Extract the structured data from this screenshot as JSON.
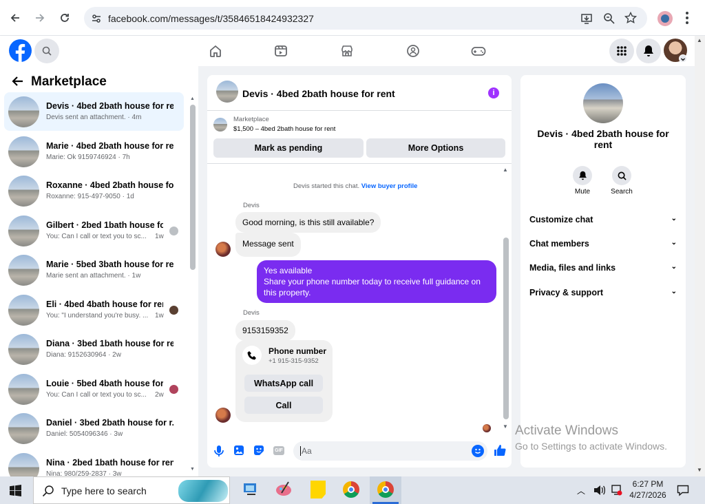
{
  "browser": {
    "url": "facebook.com/messages/t/35846518424932327"
  },
  "sidebar": {
    "title": "Marketplace",
    "conversations": [
      {
        "name": "Devis · 4bed 2bath house for rent",
        "snippet": "Devis sent an attachment. · 4m",
        "active": true
      },
      {
        "name": "Marie · 4bed 2bath house for re...",
        "snippet": "Marie: Ok 9159746924 · 7h"
      },
      {
        "name": "Roxanne · 4bed 2bath house fo...",
        "snippet": "Roxanne: 915-497-9050 · 1d"
      },
      {
        "name": "Gilbert · 2bed 1bath house fo...",
        "snippet": "You: Can I call or text you to sc...",
        "time": "1w"
      },
      {
        "name": "Marie · 5bed 3bath house for rent",
        "snippet": "Marie sent an attachment. · 1w"
      },
      {
        "name": "Eli · 4bed 4bath house for rent",
        "snippet": "You: \"I understand you're busy. ...",
        "time": "1w"
      },
      {
        "name": "Diana · 3bed 1bath house for ren",
        "snippet": "Diana: 9152630964 · 2w"
      },
      {
        "name": "Louie · 5bed 4bath house for ...",
        "snippet": "You: Can I call or text you to sc...",
        "time": "2w"
      },
      {
        "name": "Daniel · 3bed 2bath house for r...",
        "snippet": "Daniel: 5054096346 · 3w"
      },
      {
        "name": "Nina · 2bed 1bath house for rent",
        "snippet": "Nina: 980/259-2837 · 3w"
      }
    ]
  },
  "chat": {
    "title": "Devis · 4bed 2bath house for rent",
    "listing_source": "Marketplace",
    "listing_price": "$1,500 – 4bed 2bath house for rent",
    "mark_pending": "Mark as pending",
    "more_options": "More Options",
    "started_note": "Devis started this chat.",
    "buyer_profile_link": "View buyer profile",
    "sender1": "Devis",
    "msg1": "Good morning, is this still available?",
    "msg2": "Message sent",
    "my_line1": "Yes available",
    "my_line2": "Share your phone number today to receive full guidance on",
    "my_line3": "this property.",
    "sender2": "Devis",
    "msg3": "9153159352",
    "card_title": "Phone number",
    "card_number": "+1 915-315-9352",
    "whatsapp_btn": "WhatsApp call",
    "call_btn": "Call",
    "composer_placeholder": "Aa"
  },
  "info_panel": {
    "title": "Devis · 4bed 2bath house for rent",
    "mute_label": "Mute",
    "search_label": "Search",
    "sections": [
      "Customize chat",
      "Chat members",
      "Media, files and links",
      "Privacy & support"
    ]
  },
  "watermark": {
    "line1": "Activate Windows",
    "line2": "Go to Settings to activate Windows."
  },
  "taskbar": {
    "search_placeholder": "Type here to search",
    "time": "6:27 PM",
    "date": "4/27/2026"
  },
  "colors": {
    "fb_blue": "#0866ff",
    "my_bubble": "#7a2cf0",
    "active_conv": "#ebf5ff"
  }
}
